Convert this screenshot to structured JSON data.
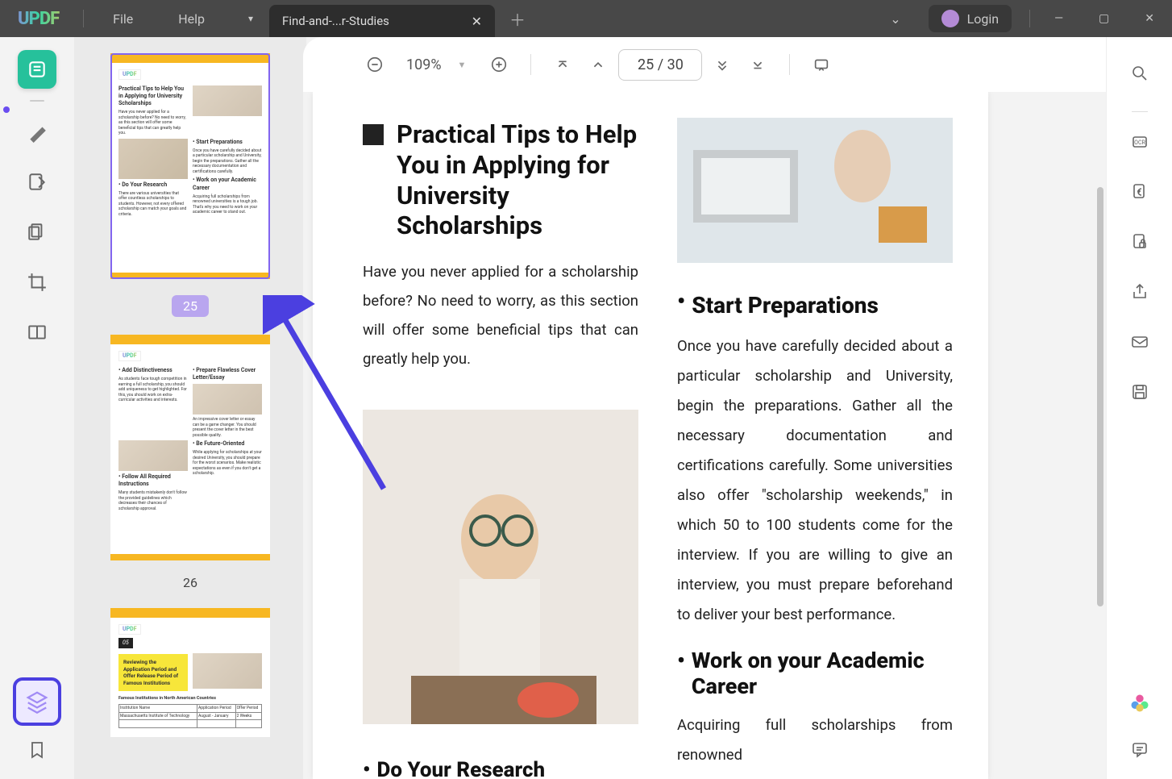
{
  "app": {
    "logo": "UPDF"
  },
  "menu": {
    "file": "File",
    "help": "Help"
  },
  "tab": {
    "title": "Find-and-...r-Studies"
  },
  "titlebar": {
    "login": "Login"
  },
  "zoom": {
    "value": "109%"
  },
  "page_input": {
    "value": "25  /  30"
  },
  "thumbs": {
    "p25": {
      "label": "25",
      "title": "Practical Tips to Help You in Applying for University Scholarships",
      "s1": "• Do Your Research",
      "s2": "• Start Preparations",
      "s3": "• Work on your Academic Career"
    },
    "p26": {
      "label": "26",
      "s1": "• Add Distinctiveness",
      "s2": "• Prepare Flawless Cover Letter/Essay",
      "s3": "• Follow All Required Instructions",
      "s4": "• Be Future-Oriented"
    },
    "p27": {
      "num": "05",
      "band": "Reviewing the Application Period and Offer Release Period of Famous Institutions",
      "tbl": "Famous Institutions in North American Countries"
    }
  },
  "doc": {
    "title": "Practical Tips to Help You in Applying for University Scholarships",
    "intro": "Have you never applied for a scholarship before? No need to worry, as this section will offer some beneficial tips that can greatly help you.",
    "h_start": "Start Preparations",
    "p_start": "Once you have carefully decided about a particular scholarship and University, begin the preparations. Gather all the necessary documentation and certifications carefully. Some universities also offer \"scholarship weekends,\" in which 50 to 100 students come for the interview. If you are willing to give an interview, you must prepare beforehand to deliver your best performance.",
    "h_work": "Work on your Academic Career",
    "p_work": "Acquiring full scholarships from renowned",
    "h_research": "Do Your Research"
  }
}
